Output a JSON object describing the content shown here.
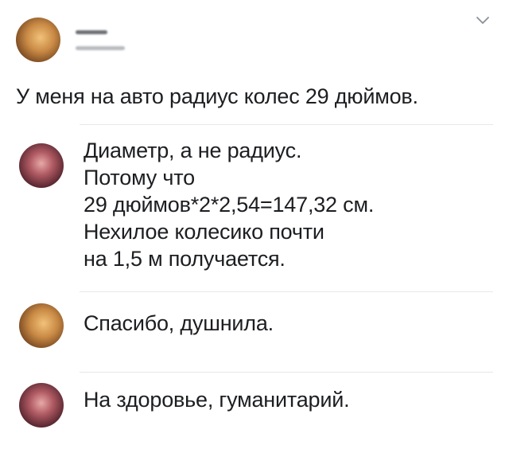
{
  "post": {
    "text": "У меня на авто радиус колес 29 дюймов."
  },
  "comments": [
    {
      "lines": [
        "Диаметр, а не радиус.",
        "Потому что",
        "29 дюймов*2*2,54=147,32 см.",
        "Нехилое колесико почти",
        "на 1,5 м получается."
      ]
    },
    {
      "lines": [
        "Спасибо, душнила."
      ]
    },
    {
      "lines": [
        "На здоровье, гуманитарий."
      ]
    }
  ],
  "icons": {
    "menu": "chevron-down-icon"
  }
}
